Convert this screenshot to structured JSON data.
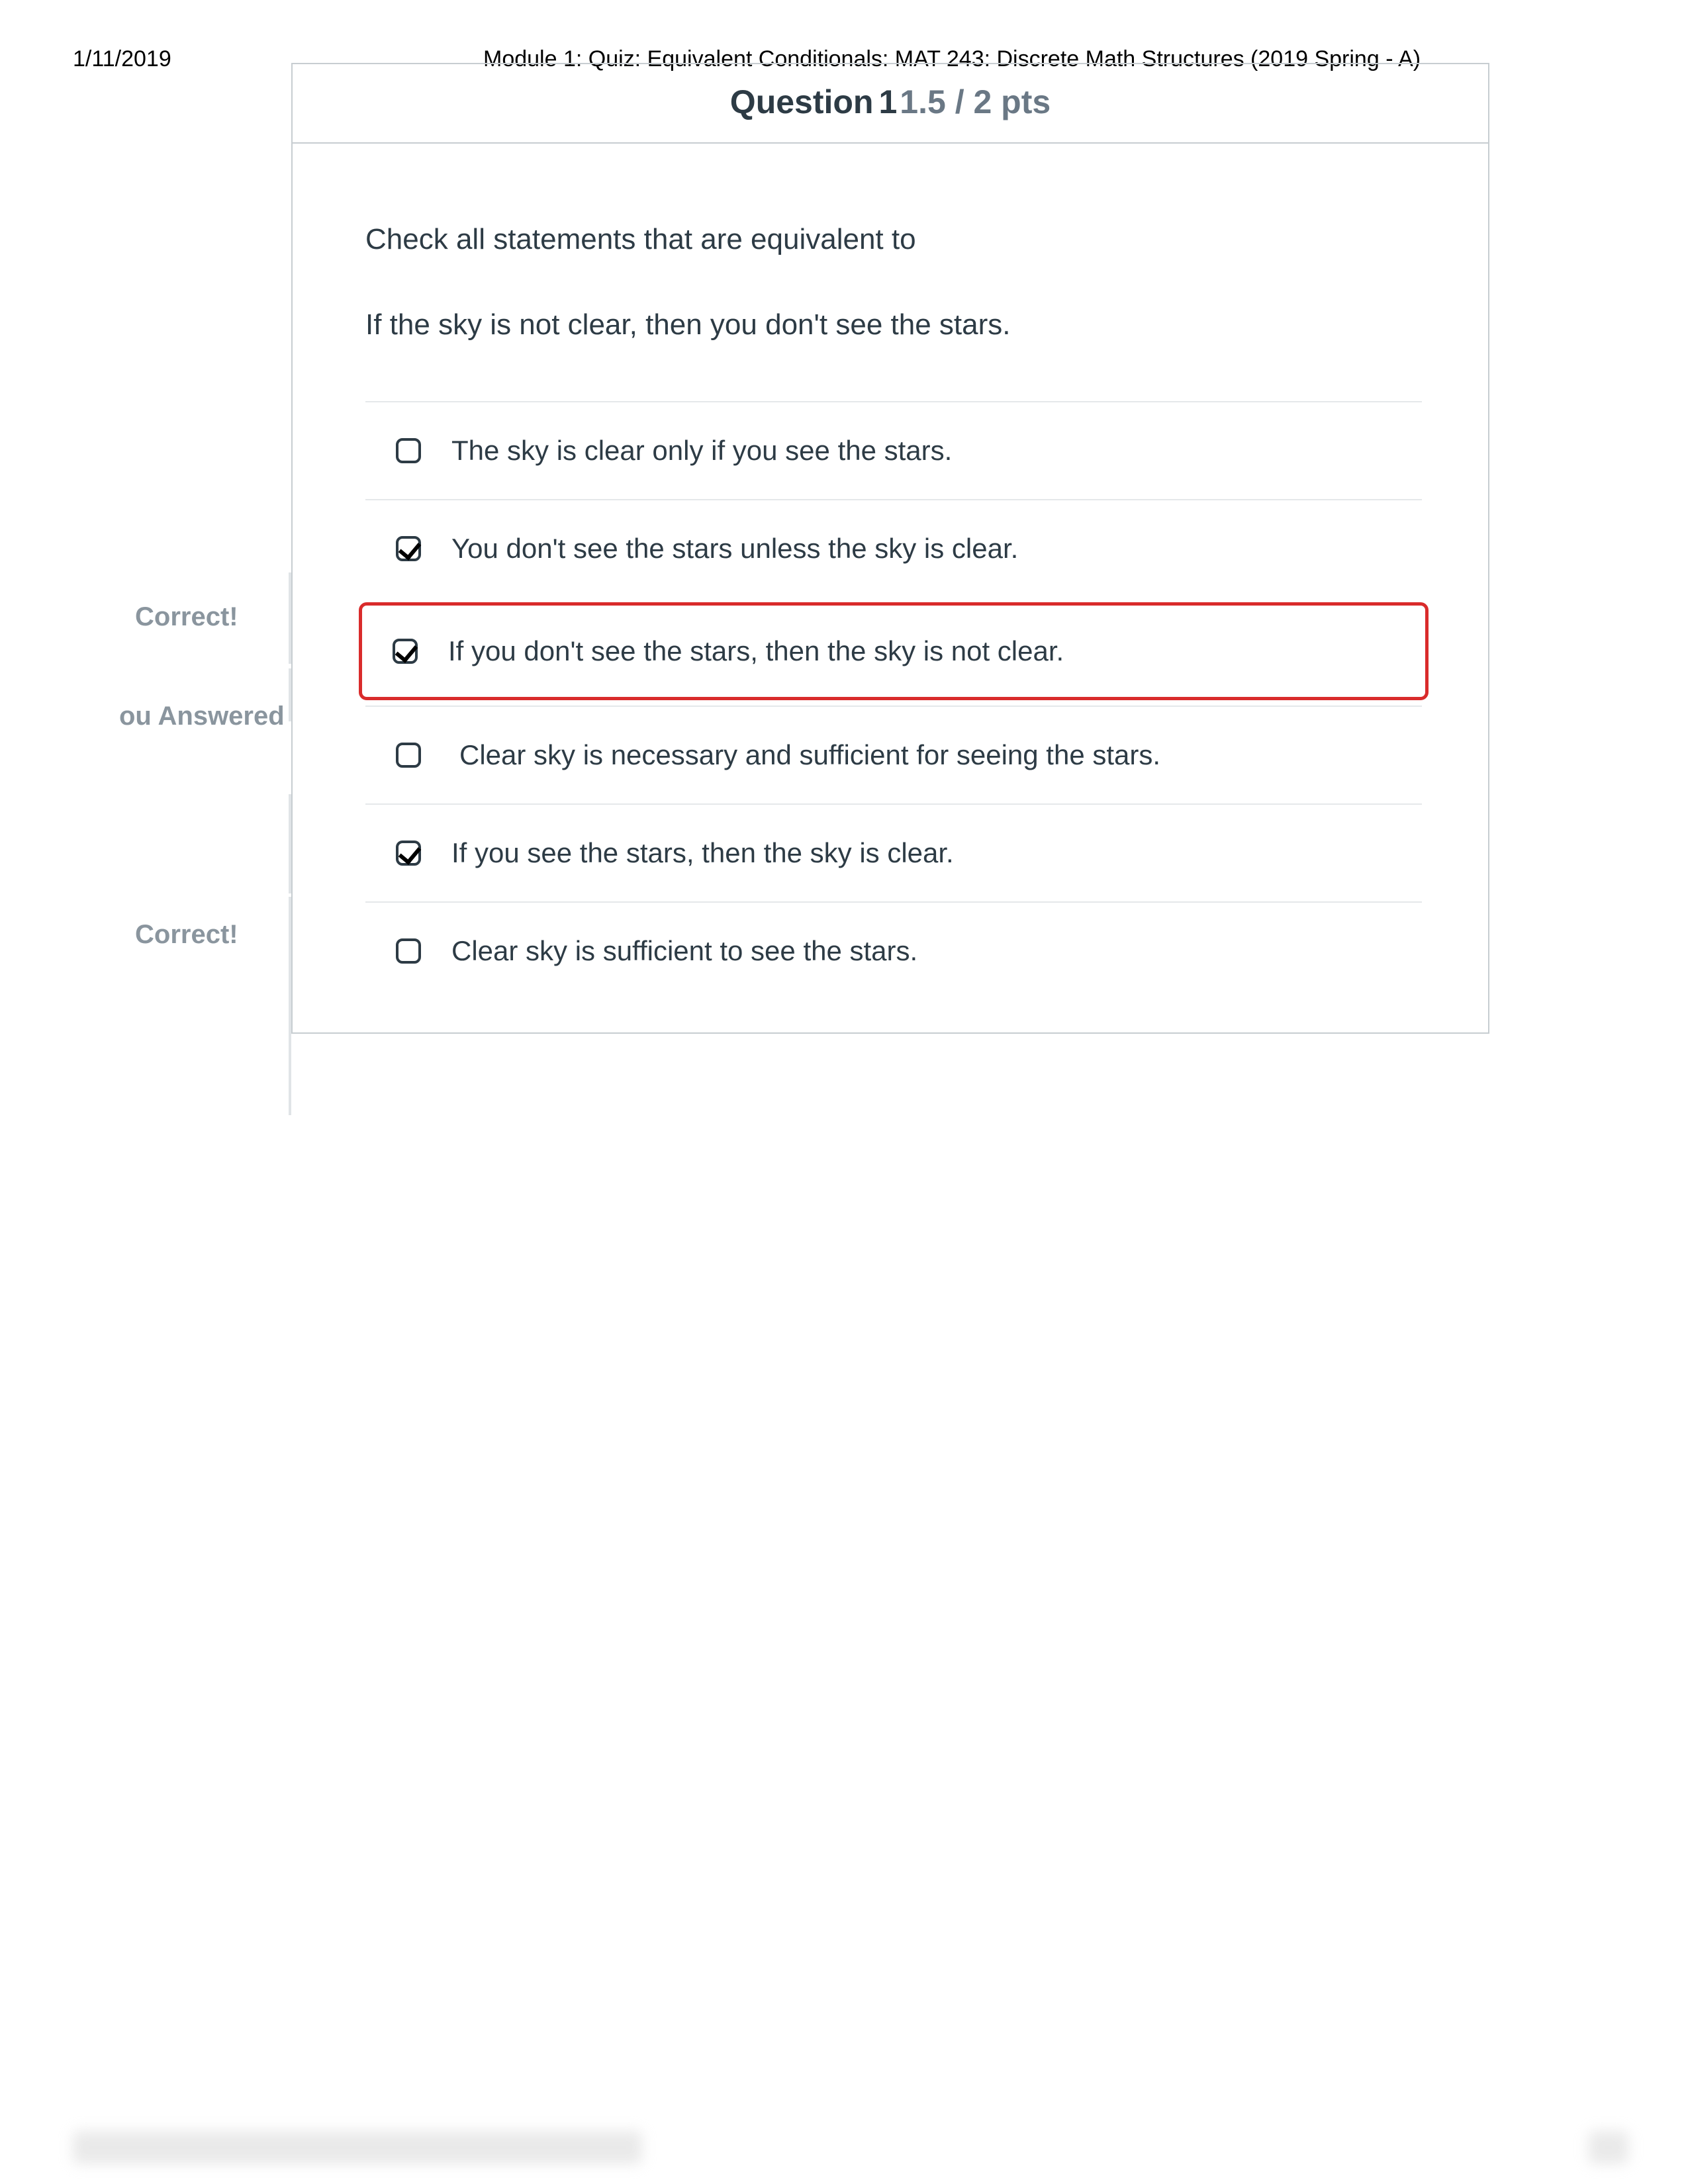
{
  "header": {
    "date": "1/11/2019",
    "title": "Module 1: Quiz: Equivalent Conditionals: MAT 243: Discrete Math Structures (2019 Spring - A)"
  },
  "question": {
    "label": "Question",
    "number": "1",
    "points": "1.5 / 2 pts",
    "prompt_line1": "Check all statements that are equivalent to",
    "prompt_line2": "If the sky is not clear, then you don't see the stars."
  },
  "feedback": {
    "correct": "Correct!",
    "you_answered": "ou Answered"
  },
  "answers": [
    {
      "checked": false,
      "text": "The sky is clear only if you see the stars.",
      "status": ""
    },
    {
      "checked": true,
      "text": "You don't see the stars unless the sky is clear.",
      "status": "correct"
    },
    {
      "checked": true,
      "text": "If you don't see the stars, then the sky is not clear.",
      "status": "you_answered"
    },
    {
      "checked": false,
      "text": "Clear sky is necessary and sufficient for seeing the stars.",
      "status": ""
    },
    {
      "checked": true,
      "text": "If you see the stars, then the sky is clear.",
      "status": "correct"
    },
    {
      "checked": false,
      "text": "Clear sky is sufficient to see the stars.",
      "status": ""
    }
  ]
}
